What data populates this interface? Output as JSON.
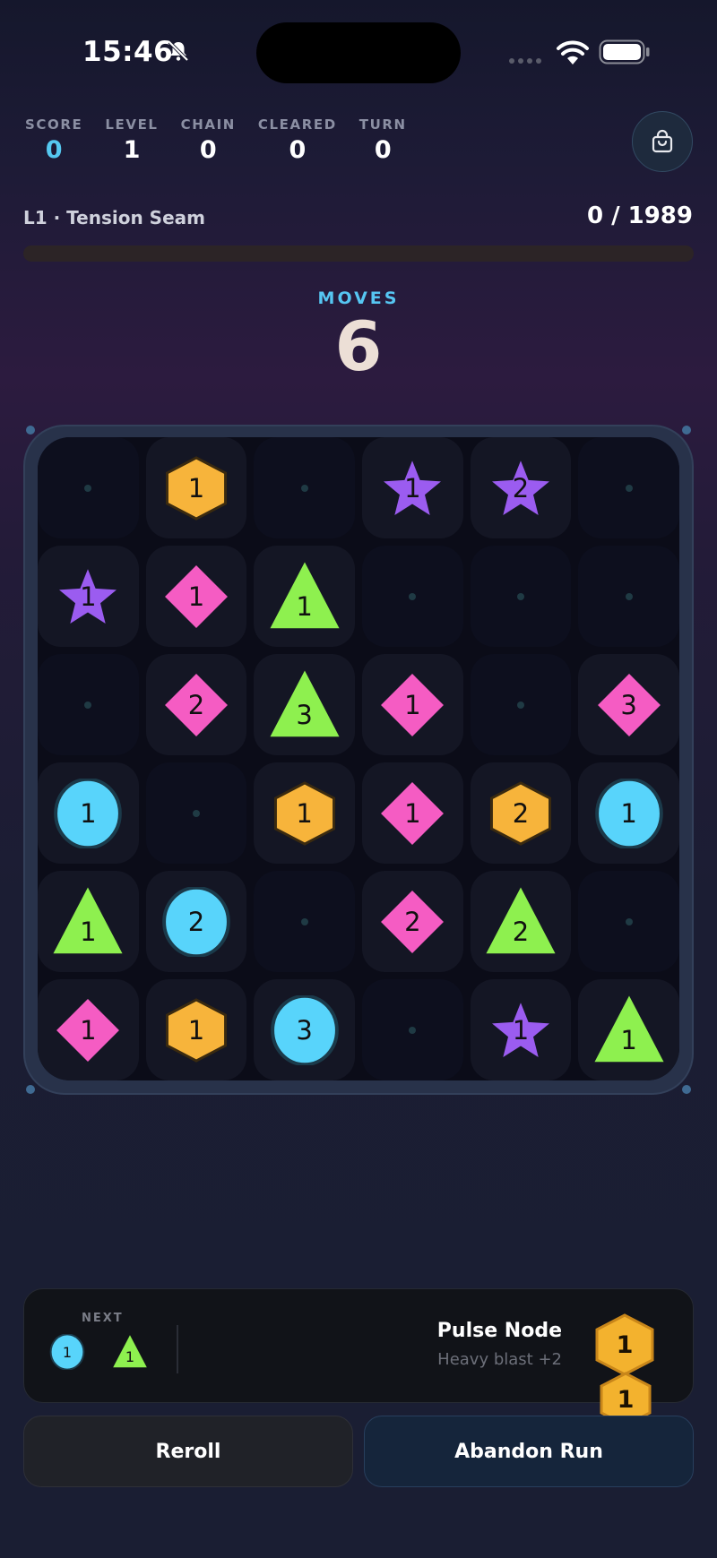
{
  "status_bar": {
    "time": "15:46"
  },
  "stats": [
    {
      "label": "SCORE",
      "value": "0",
      "accent": true
    },
    {
      "label": "LEVEL",
      "value": "1",
      "accent": false
    },
    {
      "label": "CHAIN",
      "value": "0",
      "accent": false
    },
    {
      "label": "CLEARED",
      "value": "0",
      "accent": false
    },
    {
      "label": "TURN",
      "value": "0",
      "accent": false
    }
  ],
  "shop_icon": "shopping-bag-icon",
  "level": {
    "name": "L1 · Tension Seam",
    "progress_text": "0 / 1989",
    "progress_fraction": 0
  },
  "moves": {
    "label": "MOVES",
    "value": "6"
  },
  "colors": {
    "hexagon": "#f7b43b",
    "diamond": "#f55cc3",
    "star": "#9b5cf0",
    "triangle": "#8ef04f",
    "circle": "#58d4fb",
    "accent": "#56c6f2"
  },
  "board": [
    [
      null,
      {
        "shape": "hexagon",
        "value": "1"
      },
      null,
      {
        "shape": "star",
        "value": "1"
      },
      {
        "shape": "star",
        "value": "2"
      },
      null
    ],
    [
      {
        "shape": "star",
        "value": "1"
      },
      {
        "shape": "diamond",
        "value": "1"
      },
      {
        "shape": "triangle",
        "value": "1"
      },
      null,
      null,
      null
    ],
    [
      null,
      {
        "shape": "diamond",
        "value": "2"
      },
      {
        "shape": "triangle",
        "value": "3"
      },
      {
        "shape": "diamond",
        "value": "1"
      },
      null,
      {
        "shape": "diamond",
        "value": "3"
      }
    ],
    [
      {
        "shape": "circle",
        "value": "1"
      },
      null,
      {
        "shape": "hexagon",
        "value": "1"
      },
      {
        "shape": "diamond",
        "value": "1"
      },
      {
        "shape": "hexagon",
        "value": "2"
      },
      {
        "shape": "circle",
        "value": "1"
      }
    ],
    [
      {
        "shape": "triangle",
        "value": "1"
      },
      {
        "shape": "circle",
        "value": "2"
      },
      null,
      {
        "shape": "diamond",
        "value": "2"
      },
      {
        "shape": "triangle",
        "value": "2"
      },
      null
    ],
    [
      {
        "shape": "diamond",
        "value": "1"
      },
      {
        "shape": "hexagon",
        "value": "1"
      },
      {
        "shape": "circle",
        "value": "3"
      },
      null,
      {
        "shape": "star",
        "value": "1"
      },
      {
        "shape": "triangle",
        "value": "1"
      }
    ]
  ],
  "next": {
    "label": "NEXT",
    "pieces": [
      {
        "shape": "circle",
        "value": "1"
      },
      {
        "shape": "triangle",
        "value": "1"
      }
    ]
  },
  "powerup": {
    "name": "Pulse Node",
    "description": "Heavy blast +2",
    "badges": [
      "1",
      "1"
    ]
  },
  "buttons": {
    "reroll": "Reroll",
    "abandon": "Abandon Run"
  }
}
